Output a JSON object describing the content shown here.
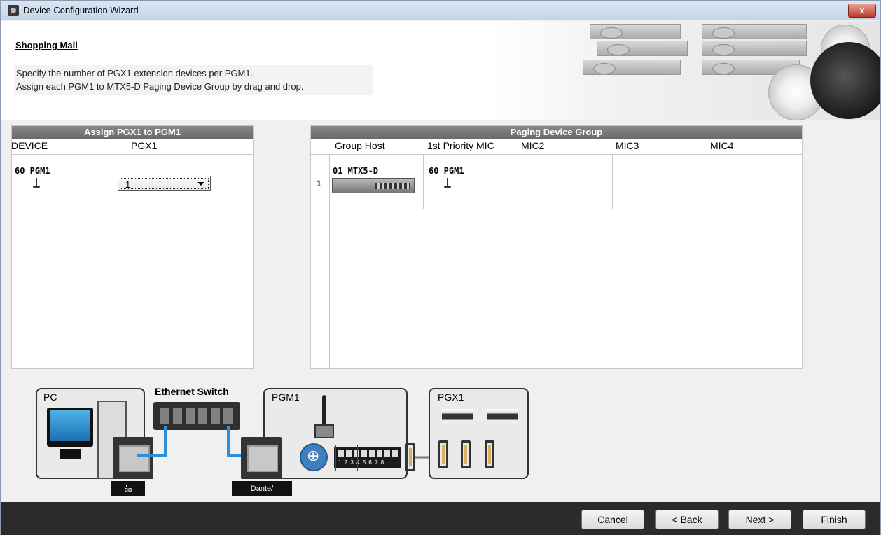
{
  "window": {
    "title": "Device Configuration Wizard",
    "close_label": "x"
  },
  "header": {
    "breadcrumb": "Shopping Mall",
    "instruction_line1": "Specify the number of PGX1 extension devices per PGM1.",
    "instruction_line2": "Assign each PGM1 to MTX5-D Paging Device Group by drag and drop."
  },
  "assign_panel": {
    "title": "Assign PGX1 to PGM1",
    "col_device": "DEVICE",
    "col_pgx1": "PGX1",
    "rows": [
      {
        "device": "60 PGM1",
        "pgx1_value": "1"
      }
    ]
  },
  "paging_panel": {
    "title": "Paging Device Group",
    "columns": [
      "Group Host",
      "1st Priority MIC",
      "MIC2",
      "MIC3",
      "MIC4"
    ],
    "rows": [
      {
        "index": "1",
        "group_host": "01 MTX5-D",
        "priority_mic": "60 PGM1"
      }
    ]
  },
  "diagram": {
    "pc_label": "PC",
    "switch_label": "Ethernet Switch",
    "pgm1_label": "PGM1",
    "pgx1_label": "PGX1",
    "dante_label": "Dante/"
  },
  "footer": {
    "cancel": "Cancel",
    "back": "< Back",
    "next": "Next >",
    "finish": "Finish"
  },
  "colors": {
    "panel_header": "#777777",
    "footer_bg": "#2b2b2b",
    "cable": "#2f8fd8"
  }
}
